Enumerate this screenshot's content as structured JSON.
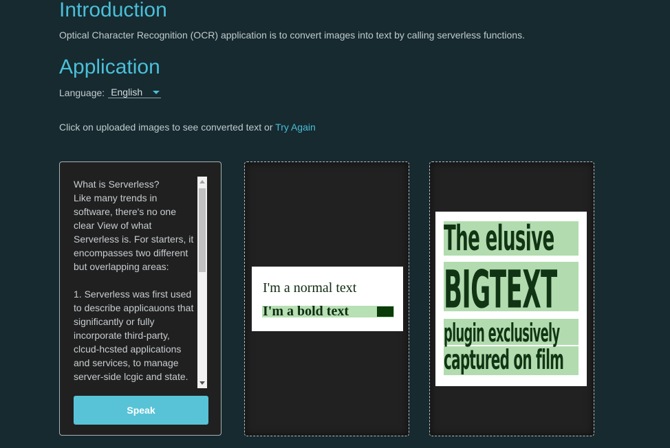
{
  "intro": {
    "title": "Introduction",
    "text": "Optical Character Recognition (OCR) application is to convert images into text by calling serverless functions."
  },
  "application": {
    "title": "Application",
    "language_label": "Language:",
    "language_value": "English",
    "hint_text": "Click on uploaded images to see converted text or ",
    "try_again_label": "Try Again"
  },
  "text_panel": {
    "content": "What is Serverless?\nLike many trends in software, there's no one clear View of what Serverless is. For starters, it encompasses two different but overlapping areas:\n\n1. Serverless was first used to describe applicauons that significantly or fully incorporate third-party, clcud-hcsted applications and services, to manage server-side lcgic and state.",
    "speak_label": "Speak"
  },
  "images": [
    {
      "line1": "I'm a normal text",
      "line2": "I'm a bold text"
    },
    {
      "line1": "The elusive",
      "line2": "BIGTEXT",
      "line3": "plugin exclusively",
      "line4": "captured on film"
    }
  ],
  "colors": {
    "background": "#162a30",
    "accent": "#4bbfd8",
    "button": "#58c3d6",
    "highlight": "#b2dcaf"
  }
}
